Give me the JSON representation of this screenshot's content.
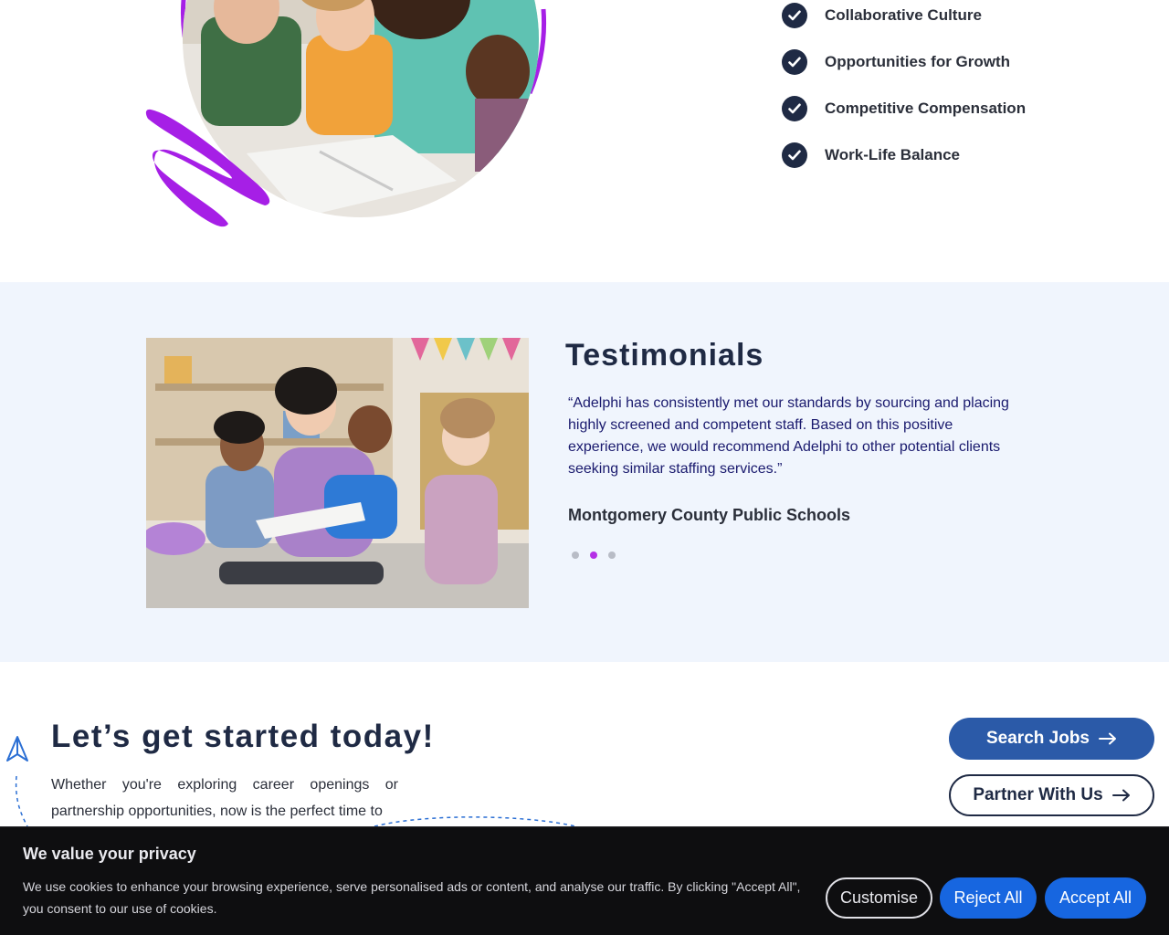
{
  "benefits": {
    "items": [
      {
        "label": "Collaborative Culture"
      },
      {
        "label": "Opportunities for Growth"
      },
      {
        "label": "Competitive Compensation"
      },
      {
        "label": "Work-Life Balance"
      }
    ]
  },
  "testimonials": {
    "title": "Testimonials",
    "quote": "“Adelphi has consistently met our standards by sourcing and placing highly screened and competent staff. Based on this positive experience, we would recommend Adelphi to other potential clients seeking similar staffing services.”",
    "author": "Montgomery County Public Schools",
    "active_slide": 2,
    "slide_count": 3
  },
  "get_started": {
    "title": "Let’s get started today!",
    "text": "Whether you're exploring career openings or partnership opportunities, now is the perfect time to",
    "search_jobs_label": "Search Jobs",
    "partner_label": "Partner With Us"
  },
  "cookie_banner": {
    "title": "We value your privacy",
    "text": "We use cookies to enhance your browsing experience, serve personalised ads or content, and analyse our traffic. By clicking \"Accept All\", you consent to our use of cookies.",
    "customise_label": "Customise",
    "reject_label": "Reject All",
    "accept_label": "Accept All"
  },
  "colors": {
    "navy": "#1f2a44",
    "accent_purple": "#b530e6",
    "button_blue": "#2b5aa8",
    "cookie_blue": "#1766e0",
    "section_bg": "#f0f5fd"
  }
}
